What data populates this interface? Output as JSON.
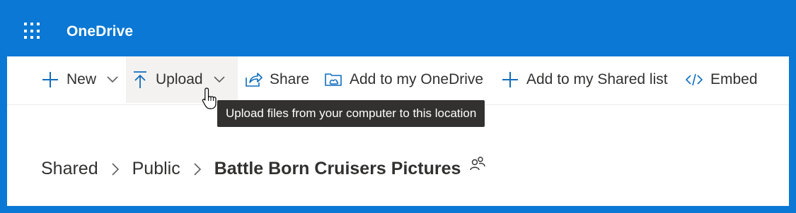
{
  "app": {
    "title": "OneDrive"
  },
  "commands": {
    "new_label": "New",
    "upload_label": "Upload",
    "share_label": "Share",
    "add_to_onedrive_label": "Add to my OneDrive",
    "add_to_shared_label": "Add to my Shared list",
    "embed_label": "Embed"
  },
  "tooltip": {
    "text": "Upload files from your computer to this location"
  },
  "breadcrumb": {
    "items": [
      "Shared",
      "Public"
    ],
    "current": "Battle Born Cruisers Pictures"
  },
  "icons": {
    "launcher": "waffle-icon",
    "new": "plus-icon",
    "upload": "upload-arrow-icon",
    "share": "share-icon",
    "add_onedrive": "add-to-onedrive-icon",
    "add_shared": "plus-icon",
    "embed": "code-icon",
    "shared_folder": "people-icon",
    "cursor": "hand-pointer-icon"
  },
  "colors": {
    "brand": "#0a78d4",
    "accent": "#0f6cbd",
    "text": "#323130",
    "tooltip_bg": "#323130",
    "hover_bg": "#f3f2f1"
  }
}
